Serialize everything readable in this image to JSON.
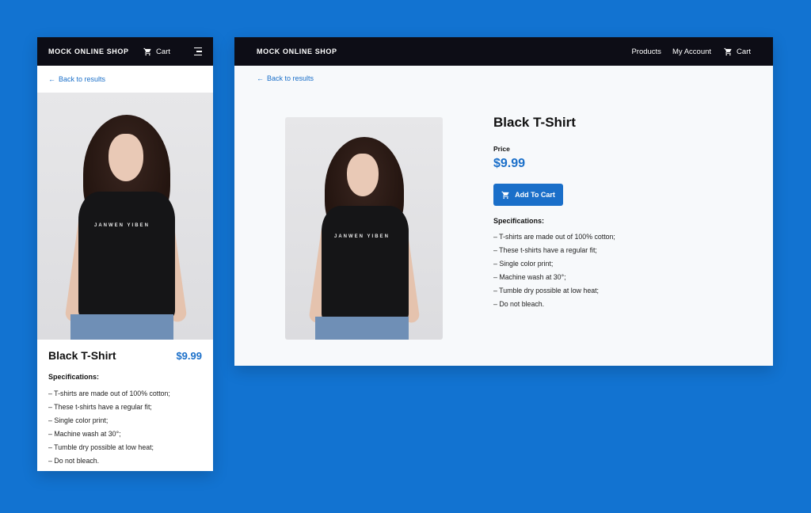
{
  "shop": {
    "brand": "MOCK ONLINE SHOP",
    "nav": {
      "products": "Products",
      "account": "My Account",
      "cart": "Cart"
    },
    "back_link": "Back to results"
  },
  "product": {
    "title": "Black T-Shirt",
    "price_label": "Price",
    "price": "$9.99",
    "add_to_cart": "Add To Cart",
    "specs_heading": "Specifications:",
    "specs": [
      "– T-shirts are made out of 100% cotton;",
      "– These t-shirts have a regular fit;",
      "– Single color print;",
      "– Machine wash at 30°;",
      "– Tumble dry possible at low heat;",
      "– Do not bleach."
    ],
    "shirt_print": "JANWEN YIBEN"
  },
  "colors": {
    "background": "#1273d1",
    "navbar": "#0d0d16",
    "accent": "#1a6fc9",
    "page": "#f7f9fb"
  },
  "icons": [
    "cart-icon",
    "menu-icon",
    "arrow-left-icon"
  ]
}
